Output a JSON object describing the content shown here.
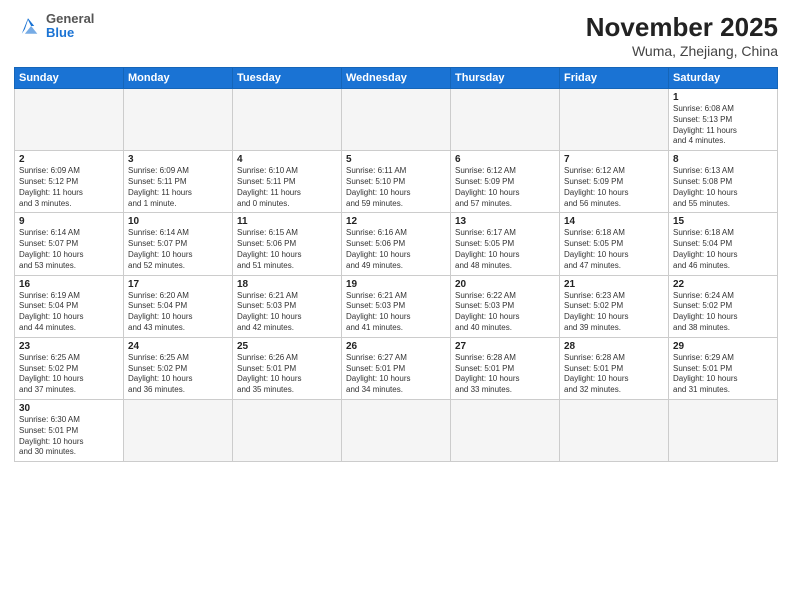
{
  "header": {
    "logo": {
      "general": "General",
      "blue": "Blue"
    },
    "title": "November 2025",
    "subtitle": "Wuma, Zhejiang, China"
  },
  "days_of_week": [
    "Sunday",
    "Monday",
    "Tuesday",
    "Wednesday",
    "Thursday",
    "Friday",
    "Saturday"
  ],
  "cells": [
    {
      "day": "",
      "text": ""
    },
    {
      "day": "",
      "text": ""
    },
    {
      "day": "",
      "text": ""
    },
    {
      "day": "",
      "text": ""
    },
    {
      "day": "",
      "text": ""
    },
    {
      "day": "",
      "text": ""
    },
    {
      "day": "1",
      "text": "Sunrise: 6:08 AM\nSunset: 5:13 PM\nDaylight: 11 hours\nand 4 minutes."
    },
    {
      "day": "2",
      "text": "Sunrise: 6:09 AM\nSunset: 5:12 PM\nDaylight: 11 hours\nand 3 minutes."
    },
    {
      "day": "3",
      "text": "Sunrise: 6:09 AM\nSunset: 5:11 PM\nDaylight: 11 hours\nand 1 minute."
    },
    {
      "day": "4",
      "text": "Sunrise: 6:10 AM\nSunset: 5:11 PM\nDaylight: 11 hours\nand 0 minutes."
    },
    {
      "day": "5",
      "text": "Sunrise: 6:11 AM\nSunset: 5:10 PM\nDaylight: 10 hours\nand 59 minutes."
    },
    {
      "day": "6",
      "text": "Sunrise: 6:12 AM\nSunset: 5:09 PM\nDaylight: 10 hours\nand 57 minutes."
    },
    {
      "day": "7",
      "text": "Sunrise: 6:12 AM\nSunset: 5:09 PM\nDaylight: 10 hours\nand 56 minutes."
    },
    {
      "day": "8",
      "text": "Sunrise: 6:13 AM\nSunset: 5:08 PM\nDaylight: 10 hours\nand 55 minutes."
    },
    {
      "day": "9",
      "text": "Sunrise: 6:14 AM\nSunset: 5:07 PM\nDaylight: 10 hours\nand 53 minutes."
    },
    {
      "day": "10",
      "text": "Sunrise: 6:14 AM\nSunset: 5:07 PM\nDaylight: 10 hours\nand 52 minutes."
    },
    {
      "day": "11",
      "text": "Sunrise: 6:15 AM\nSunset: 5:06 PM\nDaylight: 10 hours\nand 51 minutes."
    },
    {
      "day": "12",
      "text": "Sunrise: 6:16 AM\nSunset: 5:06 PM\nDaylight: 10 hours\nand 49 minutes."
    },
    {
      "day": "13",
      "text": "Sunrise: 6:17 AM\nSunset: 5:05 PM\nDaylight: 10 hours\nand 48 minutes."
    },
    {
      "day": "14",
      "text": "Sunrise: 6:18 AM\nSunset: 5:05 PM\nDaylight: 10 hours\nand 47 minutes."
    },
    {
      "day": "15",
      "text": "Sunrise: 6:18 AM\nSunset: 5:04 PM\nDaylight: 10 hours\nand 46 minutes."
    },
    {
      "day": "16",
      "text": "Sunrise: 6:19 AM\nSunset: 5:04 PM\nDaylight: 10 hours\nand 44 minutes."
    },
    {
      "day": "17",
      "text": "Sunrise: 6:20 AM\nSunset: 5:04 PM\nDaylight: 10 hours\nand 43 minutes."
    },
    {
      "day": "18",
      "text": "Sunrise: 6:21 AM\nSunset: 5:03 PM\nDaylight: 10 hours\nand 42 minutes."
    },
    {
      "day": "19",
      "text": "Sunrise: 6:21 AM\nSunset: 5:03 PM\nDaylight: 10 hours\nand 41 minutes."
    },
    {
      "day": "20",
      "text": "Sunrise: 6:22 AM\nSunset: 5:03 PM\nDaylight: 10 hours\nand 40 minutes."
    },
    {
      "day": "21",
      "text": "Sunrise: 6:23 AM\nSunset: 5:02 PM\nDaylight: 10 hours\nand 39 minutes."
    },
    {
      "day": "22",
      "text": "Sunrise: 6:24 AM\nSunset: 5:02 PM\nDaylight: 10 hours\nand 38 minutes."
    },
    {
      "day": "23",
      "text": "Sunrise: 6:25 AM\nSunset: 5:02 PM\nDaylight: 10 hours\nand 37 minutes."
    },
    {
      "day": "24",
      "text": "Sunrise: 6:25 AM\nSunset: 5:02 PM\nDaylight: 10 hours\nand 36 minutes."
    },
    {
      "day": "25",
      "text": "Sunrise: 6:26 AM\nSunset: 5:01 PM\nDaylight: 10 hours\nand 35 minutes."
    },
    {
      "day": "26",
      "text": "Sunrise: 6:27 AM\nSunset: 5:01 PM\nDaylight: 10 hours\nand 34 minutes."
    },
    {
      "day": "27",
      "text": "Sunrise: 6:28 AM\nSunset: 5:01 PM\nDaylight: 10 hours\nand 33 minutes."
    },
    {
      "day": "28",
      "text": "Sunrise: 6:28 AM\nSunset: 5:01 PM\nDaylight: 10 hours\nand 32 minutes."
    },
    {
      "day": "29",
      "text": "Sunrise: 6:29 AM\nSunset: 5:01 PM\nDaylight: 10 hours\nand 31 minutes."
    },
    {
      "day": "30",
      "text": "Sunrise: 6:30 AM\nSunset: 5:01 PM\nDaylight: 10 hours\nand 30 minutes."
    },
    {
      "day": "",
      "text": ""
    },
    {
      "day": "",
      "text": ""
    },
    {
      "day": "",
      "text": ""
    },
    {
      "day": "",
      "text": ""
    },
    {
      "day": "",
      "text": ""
    },
    {
      "day": "",
      "text": ""
    }
  ]
}
